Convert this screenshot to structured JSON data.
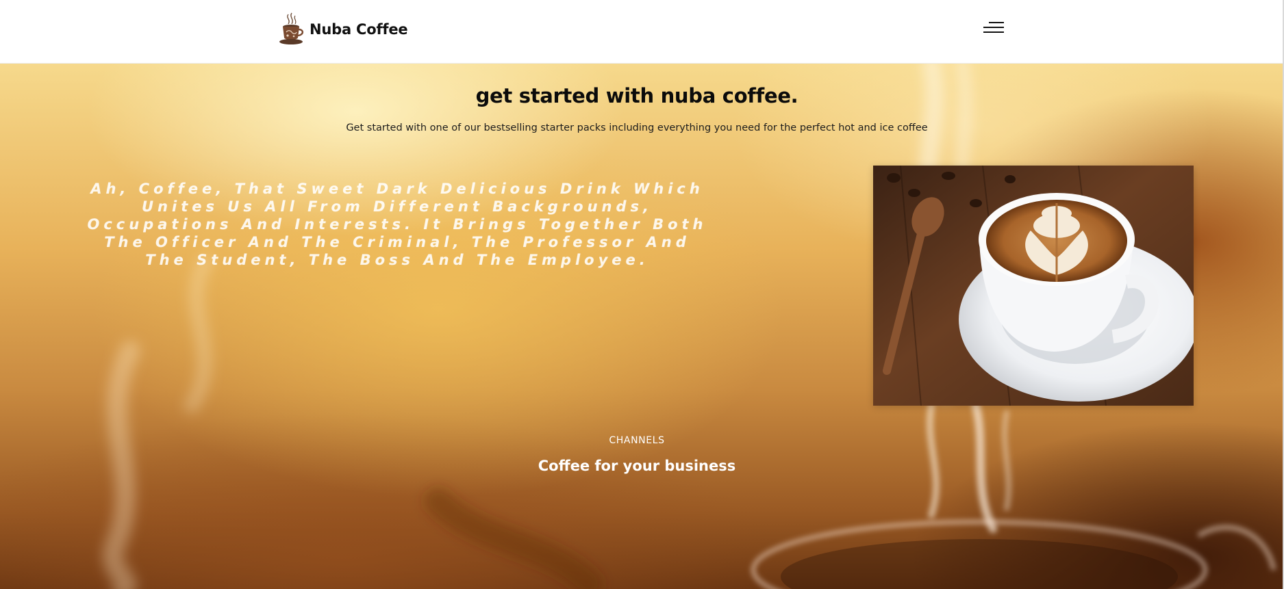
{
  "header": {
    "brand_name": "Nuba Coffee",
    "logo_icon": "coffee-cup-logo-icon",
    "menu_icon": "hamburger-menu-icon"
  },
  "hero": {
    "title": "get started with nuba coffee.",
    "subtitle": "Get started with one of our bestselling starter packs including everything you need for the perfect hot and ice coffee",
    "quote": "Ah, Coffee, That Sweet Dark Delicious Drink Which Unites Us All From Different Backgrounds, Occupations And Interests. It Brings Together Both The Officer And The Criminal, The Professor And The Student, The Boss And The Employee.",
    "photo_description": "latte-art-coffee-cup-photo"
  },
  "channels": {
    "label": "CHANNELS",
    "title": "Coffee for your business"
  },
  "colors": {
    "text_dark": "#0b0b0b",
    "header_bg": "#ffffff",
    "hero_warm": "#e8b25a",
    "hero_dark": "#6b3612",
    "white_text": "#ffffff"
  }
}
